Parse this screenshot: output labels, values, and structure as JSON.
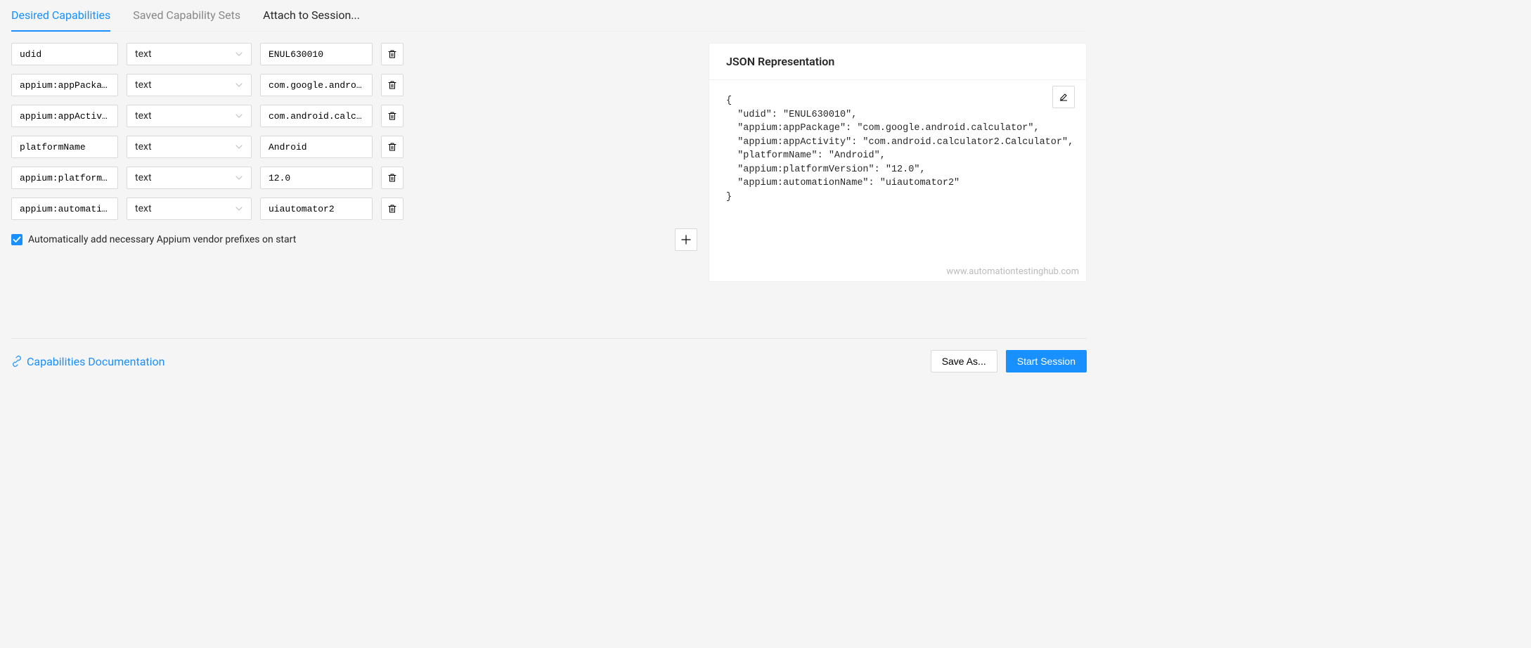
{
  "tabs": {
    "desired": "Desired Capabilities",
    "saved": "Saved Capability Sets",
    "attach": "Attach to Session..."
  },
  "capabilities": [
    {
      "name": "udid",
      "type": "text",
      "value": "ENUL630010"
    },
    {
      "name": "appium:appPackage",
      "type": "text",
      "value": "com.google.android.calculator"
    },
    {
      "name": "appium:appActivity",
      "type": "text",
      "value": "com.android.calculator2.Calculator"
    },
    {
      "name": "platformName",
      "type": "text",
      "value": "Android"
    },
    {
      "name": "appium:platformVersion",
      "type": "text",
      "value": "12.0"
    },
    {
      "name": "appium:automationName",
      "type": "text",
      "value": "uiautomator2"
    }
  ],
  "checkbox": {
    "checked": true,
    "label": "Automatically add necessary Appium vendor prefixes on start"
  },
  "json_panel": {
    "title": "JSON Representation",
    "content": "{\n  \"udid\": \"ENUL630010\",\n  \"appium:appPackage\": \"com.google.android.calculator\",\n  \"appium:appActivity\": \"com.android.calculator2.Calculator\",\n  \"platformName\": \"Android\",\n  \"appium:platformVersion\": \"12.0\",\n  \"appium:automationName\": \"uiautomator2\"\n}",
    "watermark": "www.automationtestinghub.com"
  },
  "footer": {
    "doc_link": "Capabilities Documentation",
    "save_as": "Save As...",
    "start_session": "Start Session"
  }
}
